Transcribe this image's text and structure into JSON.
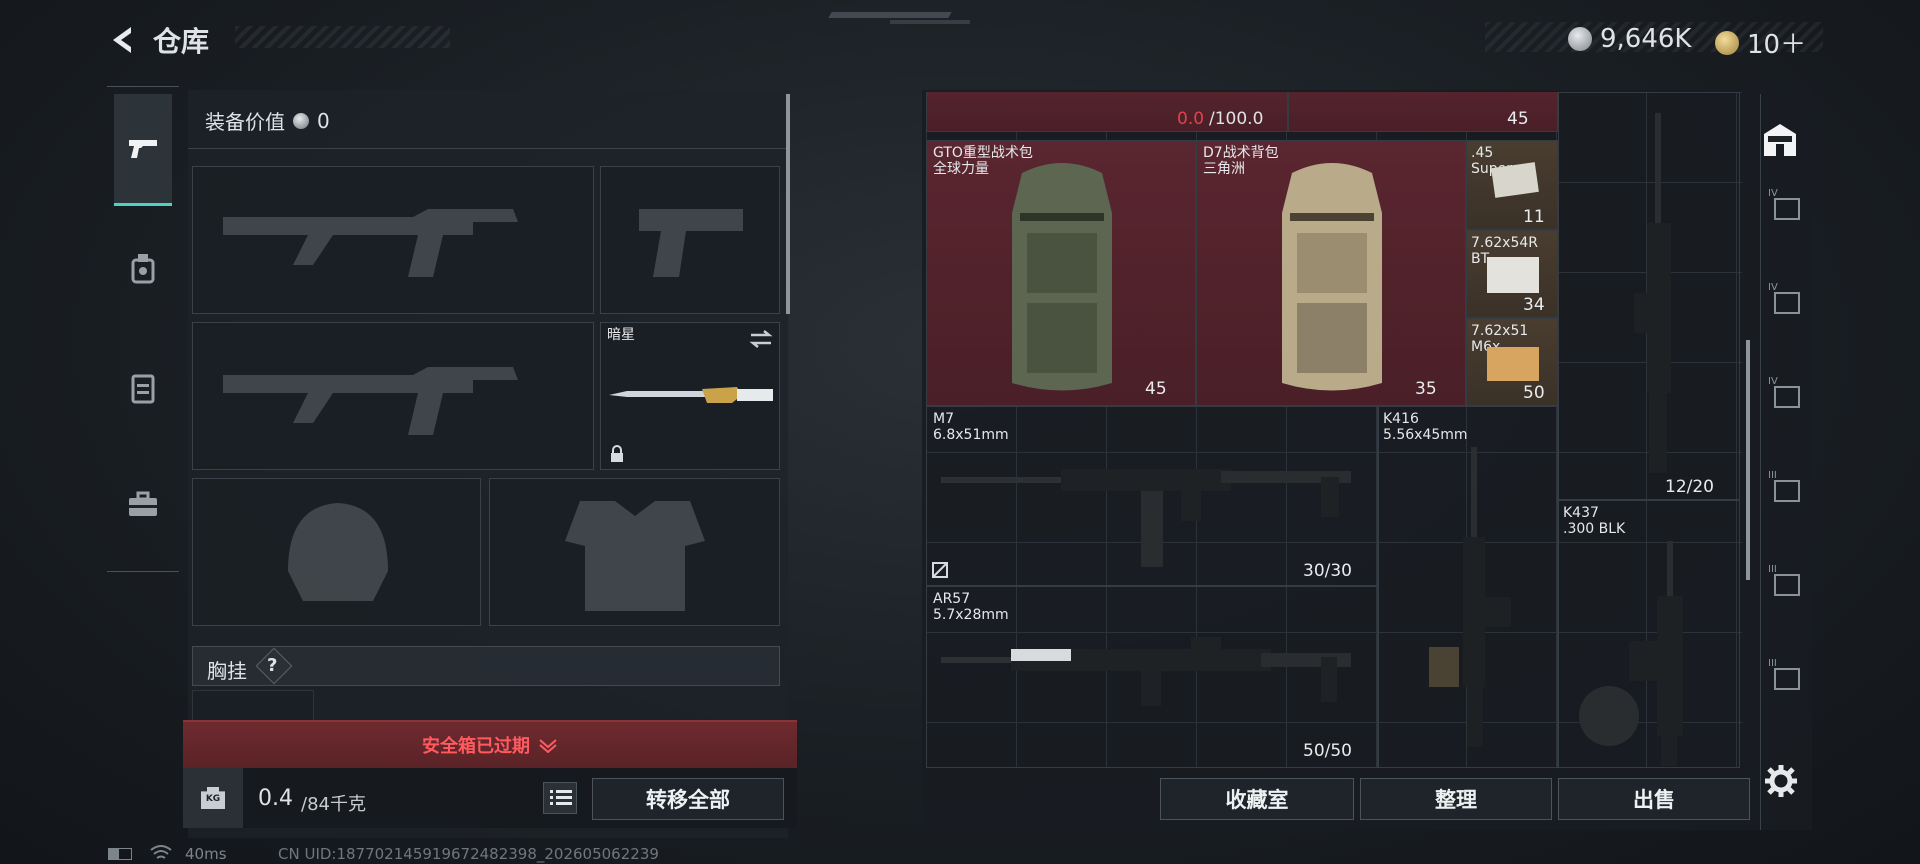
{
  "header": {
    "back_label": "仓库",
    "currency1_value": "9,646K",
    "currency2_value": "10＋"
  },
  "left": {
    "equip_value_label": "装备价值",
    "equip_value": "0",
    "knife_name": "暗星",
    "chest_rig_label": "胸挂",
    "chest_rig_help": "?",
    "safebox_text": "安全箱已过期",
    "weight_value": "0.4",
    "weight_max": "/84千克",
    "kg_icon_text": "KG",
    "transfer_all_label": "转移全部"
  },
  "status": {
    "ping": "40ms",
    "uid": "CN UID:18770214591967248239​8_202605062239"
  },
  "right": {
    "top_durability": "0.0",
    "top_durability_max": "/100.0",
    "top_count": "45",
    "items": [
      {
        "name": "GTO重型战术包",
        "sub": "全球力量",
        "count": "45"
      },
      {
        "name": "D7战术背包",
        "sub": "三角洲",
        "count": "35"
      },
      {
        "name": ".45",
        "sub": "Super",
        "count": "11"
      },
      {
        "name": "7.62x54R",
        "sub": "BT",
        "count": "34"
      },
      {
        "name": "7.62x51",
        "sub": "M6x",
        "count": "50"
      },
      {
        "name": "M7",
        "sub": "6.8x51mm",
        "count": "30/30"
      },
      {
        "name": "K416",
        "sub": "5.56x45mm",
        "count": ""
      },
      {
        "name": "AR57",
        "sub": "5.7x28mm",
        "count": "50/50"
      },
      {
        "name": "K437",
        "sub": ".300 BLK",
        "count": ""
      },
      {
        "name": "",
        "sub": "",
        "count": "12/20"
      }
    ],
    "btn_collection": "收藏室",
    "btn_sort": "整理",
    "btn_sell": "出售"
  },
  "side_tabs": [
    "IV",
    "IV",
    "IV",
    "III",
    "III",
    "III"
  ],
  "colors": {
    "accent_red": "#c8313a",
    "durability_red": "#e0434b",
    "cell_red": "#4d2029",
    "bg": "#1a1f24"
  }
}
